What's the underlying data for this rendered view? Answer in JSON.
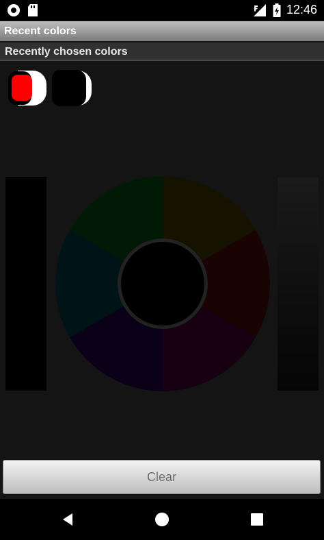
{
  "status_bar": {
    "time": "12:46",
    "left_icons": [
      "record-icon",
      "sd-card-icon"
    ],
    "right_icons": [
      "signal-icon",
      "battery-icon"
    ]
  },
  "app": {
    "title": "Recent colors"
  },
  "section": {
    "title": "Recently chosen colors"
  },
  "recent_colors": [
    {
      "name": "red",
      "color": "#ff0000"
    },
    {
      "name": "black",
      "color": "#000000"
    }
  ],
  "actions": {
    "clear_label": "Clear"
  },
  "nav": {
    "icons": [
      "back-icon",
      "home-icon",
      "recents-icon"
    ]
  }
}
